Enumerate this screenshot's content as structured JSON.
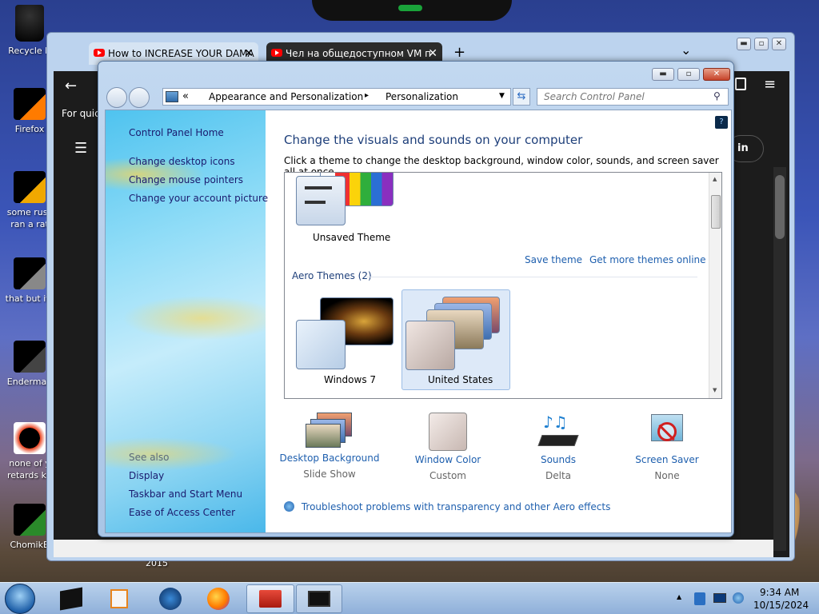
{
  "desktop": {
    "icons": [
      {
        "label": "Recycle Bin",
        "display": "Recycle B"
      },
      {
        "label": "Firefox"
      },
      {
        "label": "some russ",
        "line2": "ran a rat"
      },
      {
        "label": "that but its"
      },
      {
        "label": "Enderman"
      },
      {
        "label": "none of y",
        "line2": "retards kn"
      },
      {
        "label": "ChomikB"
      }
    ],
    "stray_label": "2015"
  },
  "browser": {
    "tabs": [
      {
        "title": "How to INCREASE YOUR DAMA",
        "close": "✕"
      },
      {
        "title": "Чел на общедоступном VM п",
        "close": "✕"
      }
    ],
    "new_tab": "+",
    "tab_menu": "⌄",
    "back": "←",
    "page_snippet": "For quick",
    "sign_in": "in",
    "menu_icon": "≡"
  },
  "window": {
    "caption_min": "▬",
    "caption_max": "▫",
    "caption_close": "✕",
    "breadcrumb": {
      "prefix": "«",
      "items": [
        "Appearance and Personalization",
        "Personalization"
      ],
      "sep": "▸"
    },
    "search_placeholder": "Search Control Panel"
  },
  "left_pane": {
    "home": "Control Panel Home",
    "links": [
      "Change desktop icons",
      "Change mouse pointers",
      "Change your account picture"
    ],
    "see_also_title": "See also",
    "see_also": [
      "Display",
      "Taskbar and Start Menu",
      "Ease of Access Center"
    ]
  },
  "main": {
    "title": "Change the visuals and sounds on your computer",
    "subtitle": "Click a theme to change the desktop background, window color, sounds, and screen saver all at once.",
    "unsaved_theme": "Unsaved Theme",
    "save_theme": "Save theme",
    "get_more": "Get more themes online",
    "aero_header": "Aero Themes (2)",
    "themes": [
      "Windows 7",
      "United States"
    ],
    "categories": [
      {
        "label": "Desktop Background",
        "value": "Slide Show"
      },
      {
        "label": "Window Color",
        "value": "Custom"
      },
      {
        "label": "Sounds",
        "value": "Delta"
      },
      {
        "label": "Screen Saver",
        "value": "None"
      }
    ],
    "troubleshoot": "Troubleshoot problems with transparency and other Aero effects"
  },
  "taskbar": {
    "time": "9:34 AM",
    "date": "10/15/2024",
    "tray_arrow": "▲"
  }
}
